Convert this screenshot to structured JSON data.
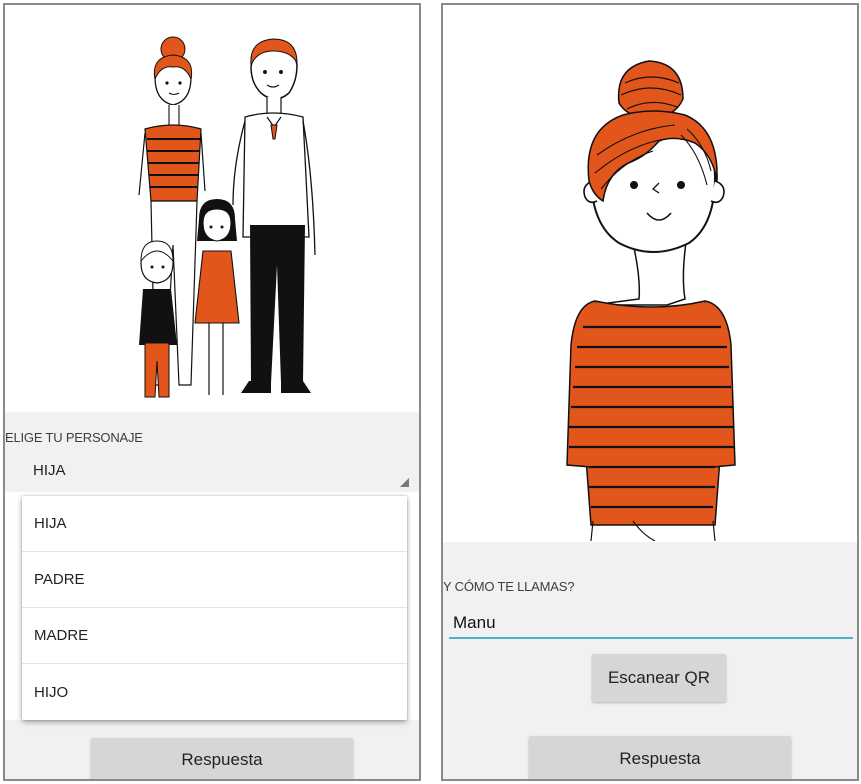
{
  "left_screen": {
    "character_label": "ELIGE TU PERSONAJE",
    "selected_character": "HIJA",
    "options": [
      "HIJA",
      "PADRE",
      "MADRE",
      "HIJO"
    ],
    "answer_button": "Respuesta"
  },
  "right_screen": {
    "name_label": "Y CÓMO TE LLAMAS?",
    "name_value": "Manu",
    "scan_button": "Escanear QR",
    "answer_button": "Respuesta"
  },
  "colors": {
    "accent_orange": "#e2561b",
    "input_underline": "#51b1c9",
    "button_gray": "#d6d6d6",
    "panel_gray": "#f1f1f1"
  }
}
